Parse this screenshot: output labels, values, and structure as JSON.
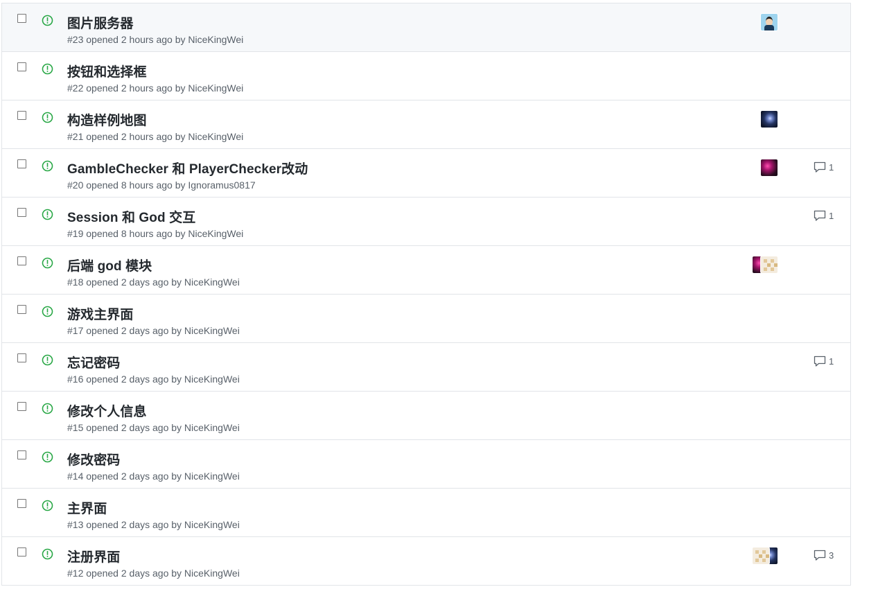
{
  "issues": [
    {
      "title": "图片服务器",
      "meta": "#23 opened 2 hours ago by NiceKingWei",
      "avatars": [
        "face"
      ],
      "comments": "",
      "hover": true
    },
    {
      "title": "按钮和选择框",
      "meta": "#22 opened 2 hours ago by NiceKingWei",
      "avatars": [],
      "comments": ""
    },
    {
      "title": "构造样例地图",
      "meta": "#21 opened 2 hours ago by NiceKingWei",
      "avatars": [
        "night"
      ],
      "comments": ""
    },
    {
      "title": "GambleChecker 和 PlayerChecker改动",
      "meta": "#20 opened 8 hours ago by Ignoramus0817",
      "avatars": [
        "pink"
      ],
      "comments": "1"
    },
    {
      "title": "Session 和 God 交互",
      "meta": "#19 opened 8 hours ago by NiceKingWei",
      "avatars": [],
      "comments": "1"
    },
    {
      "title": "后端 god 模块",
      "meta": "#18 opened 2 days ago by NiceKingWei",
      "avatars": [
        "pink",
        "beige"
      ],
      "comments": ""
    },
    {
      "title": "游戏主界面",
      "meta": "#17 opened 2 days ago by NiceKingWei",
      "avatars": [],
      "comments": ""
    },
    {
      "title": "忘记密码",
      "meta": "#16 opened 2 days ago by NiceKingWei",
      "avatars": [],
      "comments": "1"
    },
    {
      "title": "修改个人信息",
      "meta": "#15 opened 2 days ago by NiceKingWei",
      "avatars": [],
      "comments": ""
    },
    {
      "title": "修改密码",
      "meta": "#14 opened 2 days ago by NiceKingWei",
      "avatars": [],
      "comments": ""
    },
    {
      "title": "主界面",
      "meta": "#13 opened 2 days ago by NiceKingWei",
      "avatars": [],
      "comments": ""
    },
    {
      "title": "注册界面",
      "meta": "#12 opened 2 days ago by NiceKingWei",
      "avatars": [
        "beige",
        "night"
      ],
      "comments": "3"
    }
  ],
  "colors": {
    "open_icon": "#28a745",
    "title": "#24292e",
    "meta": "#586069",
    "border": "#e1e4e8"
  },
  "icons": {
    "state": "issue-opened-icon",
    "comment": "comment-icon"
  }
}
